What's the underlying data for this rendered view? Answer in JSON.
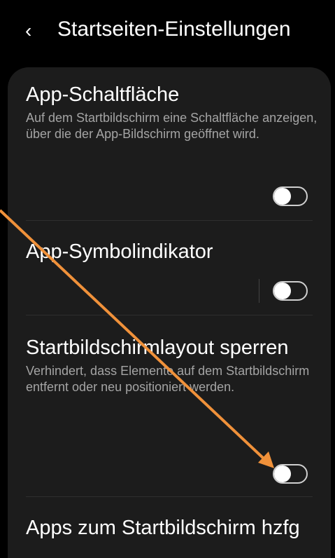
{
  "header": {
    "back_icon": "‹",
    "title": "Startseiten-Einstellungen"
  },
  "settings": [
    {
      "title": "App-Schaltfläche",
      "description": "Auf dem Startbildschirm eine Schaltfläche anzeigen, über die der App-Bildschirm geöffnet wird.",
      "enabled": false
    },
    {
      "title": "App-Symbolindikator",
      "description": "",
      "enabled": false
    },
    {
      "title": "Startbildschirmlayout sperren",
      "description": "Verhindert, dass Elemente auf dem Startbildschirm entfernt oder neu positioniert werden.",
      "enabled": false
    },
    {
      "title": "Apps zum Startbildschirm hzfg"
    }
  ],
  "colors": {
    "background": "#000000",
    "card": "#1c1c1c",
    "annotation_arrow": "#f0913a"
  }
}
